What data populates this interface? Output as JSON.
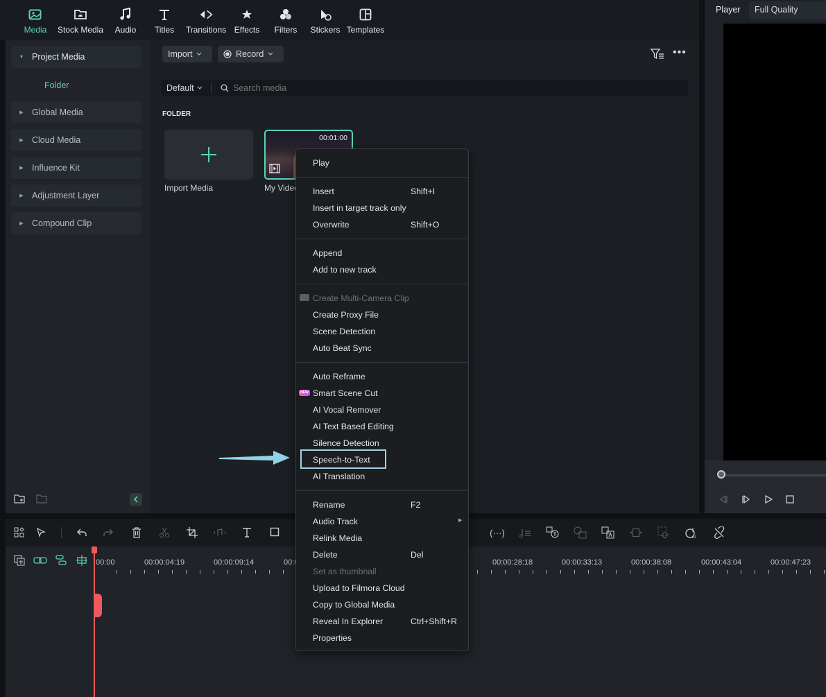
{
  "toolbar": {
    "items": [
      {
        "label": "Media",
        "icon": "media-icon",
        "active": true
      },
      {
        "label": "Stock Media",
        "icon": "stock-media-icon"
      },
      {
        "label": "Audio",
        "icon": "music-note-icon"
      },
      {
        "label": "Titles",
        "icon": "titles-icon"
      },
      {
        "label": "Transitions",
        "icon": "transitions-icon"
      },
      {
        "label": "Effects",
        "icon": "effects-star-icon"
      },
      {
        "label": "Filters",
        "icon": "filters-icon"
      },
      {
        "label": "Stickers",
        "icon": "stickers-icon"
      },
      {
        "label": "Templates",
        "icon": "templates-icon"
      }
    ]
  },
  "player": {
    "label": "Player",
    "quality": "Full Quality"
  },
  "sidebar": {
    "items": [
      {
        "label": "Project Media",
        "expanded": true
      },
      {
        "label": "Global Media"
      },
      {
        "label": "Cloud Media"
      },
      {
        "label": "Influence Kit"
      },
      {
        "label": "Adjustment Layer"
      },
      {
        "label": "Compound Clip"
      }
    ],
    "sub_folder": "Folder"
  },
  "media": {
    "import_label": "Import",
    "record_label": "Record",
    "sort_label": "Default",
    "search_placeholder": "Search media",
    "folder_heading": "FOLDER",
    "import_tile_label": "Import Media",
    "video_tile": {
      "label": "My Video",
      "duration": "00:01:00"
    }
  },
  "context_menu": {
    "items": [
      {
        "label": "Play"
      },
      {
        "label": "Insert",
        "shortcut": "Shift+I"
      },
      {
        "label": "Insert in target track only"
      },
      {
        "label": "Overwrite",
        "shortcut": "Shift+O"
      },
      {
        "label": "Append"
      },
      {
        "label": "Add to new track"
      },
      {
        "label": "Create Multi-Camera Clip",
        "disabled": true
      },
      {
        "label": "Create Proxy File"
      },
      {
        "label": "Scene Detection"
      },
      {
        "label": "Auto Beat Sync"
      },
      {
        "label": "Auto Reframe"
      },
      {
        "label": "Smart Scene Cut",
        "badge": "NEW"
      },
      {
        "label": "AI Vocal Remover"
      },
      {
        "label": "AI Text Based Editing"
      },
      {
        "label": "Silence Detection"
      },
      {
        "label": "Speech-to-Text",
        "highlighted": true
      },
      {
        "label": "AI Translation"
      },
      {
        "label": "Rename",
        "shortcut": "F2"
      },
      {
        "label": "Audio Track",
        "submenu": true
      },
      {
        "label": "Relink Media"
      },
      {
        "label": "Delete",
        "shortcut": "Del"
      },
      {
        "label": "Set as thumbnail",
        "disabled": true
      },
      {
        "label": "Upload to Filmora Cloud"
      },
      {
        "label": "Copy to Global Media"
      },
      {
        "label": "Reveal In Explorer",
        "shortcut": "Ctrl+Shift+R"
      },
      {
        "label": "Properties"
      }
    ]
  },
  "timeline": {
    "ruler_labels": [
      "00:00",
      "00:00:04:19",
      "00:00:09:14",
      "00:0",
      "00:00:28:18",
      "00:00:33:13",
      "00:00:38:08",
      "00:00:43:04",
      "00:00:47:23"
    ]
  },
  "colors": {
    "accent": "#5ad2b7",
    "highlight_box": "#9fd2e4",
    "playhead": "#f0585f"
  }
}
